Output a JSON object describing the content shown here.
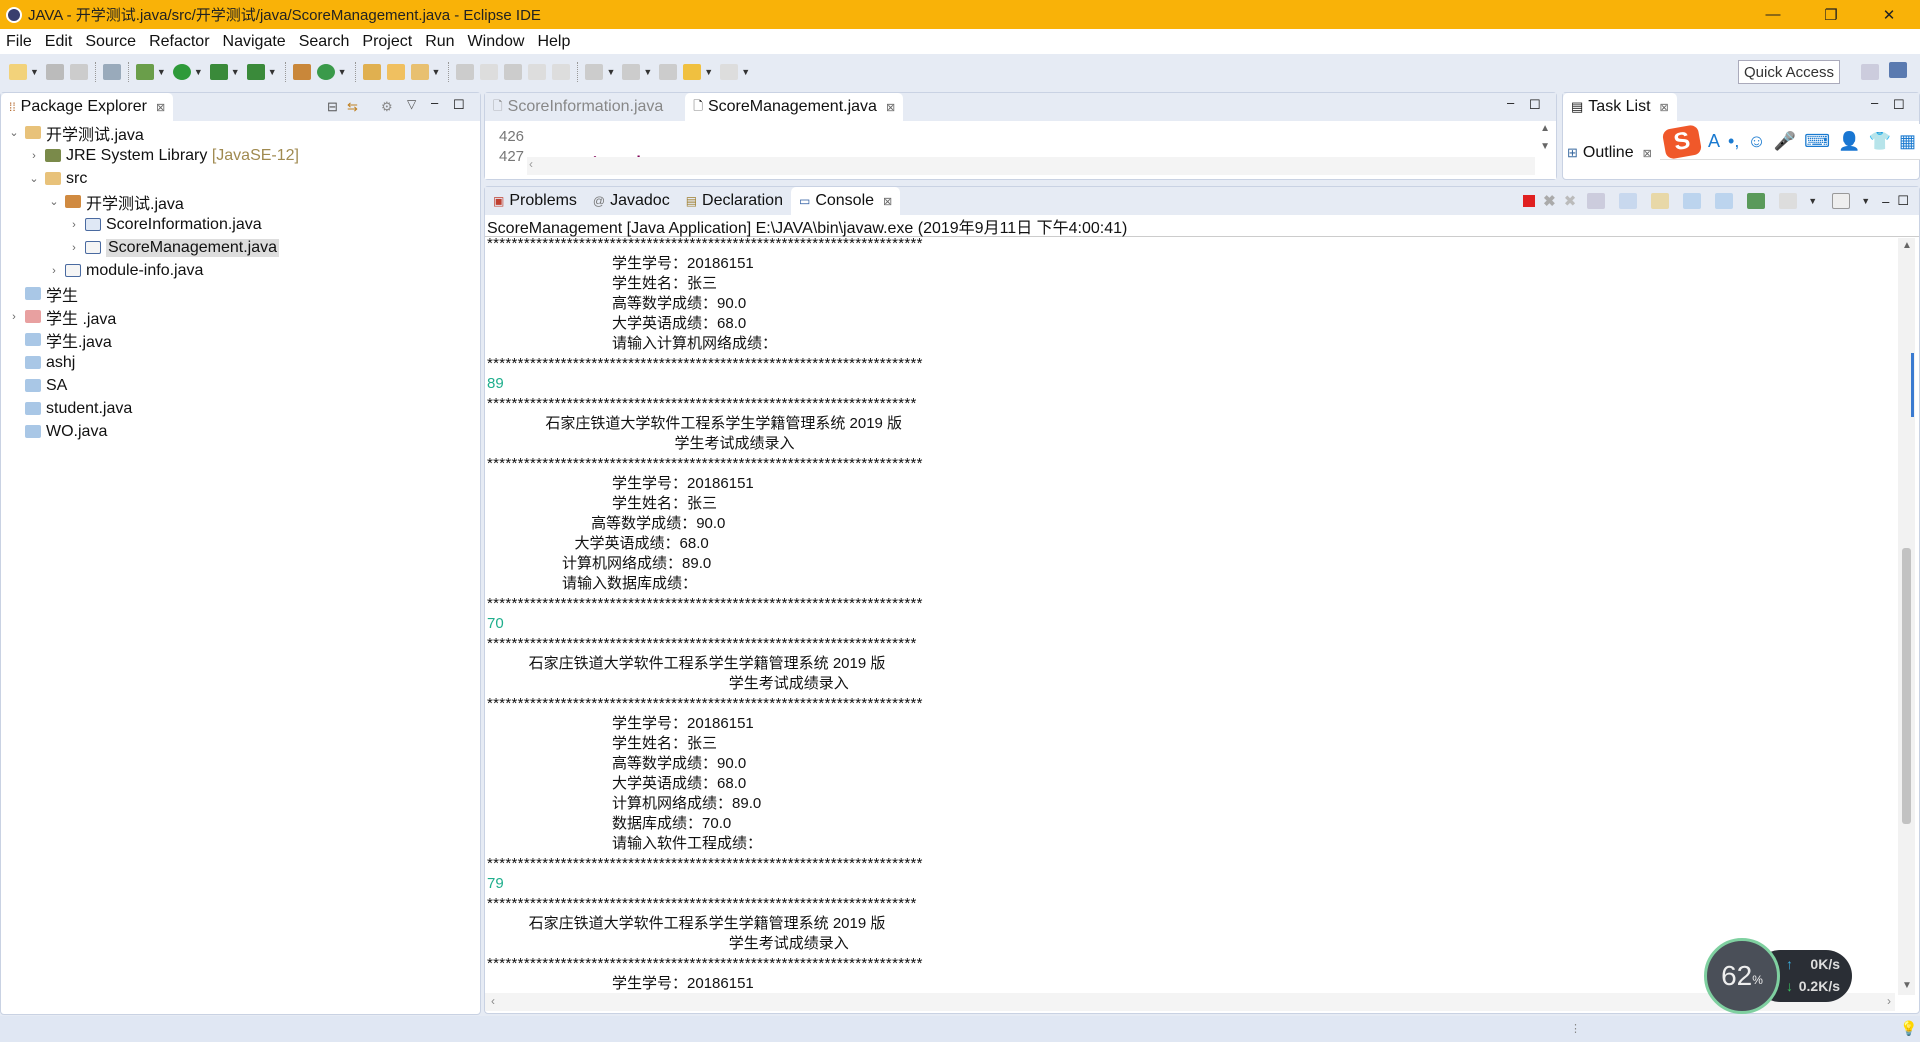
{
  "window": {
    "title": "JAVA - 开学测试.java/src/开学测试/java/ScoreManagement.java - Eclipse IDE",
    "minimize": "—",
    "restore": "❐",
    "close": "✕"
  },
  "menu": [
    "File",
    "Edit",
    "Source",
    "Refactor",
    "Navigate",
    "Search",
    "Project",
    "Run",
    "Window",
    "Help"
  ],
  "toolbar": {
    "quick_access": "Quick Access"
  },
  "package_explorer": {
    "title": "Package Explorer",
    "items": [
      {
        "label": "开学测试.java",
        "toggle": "⌄"
      },
      {
        "label": "JRE System Library",
        "decoration": "[JavaSE-12]",
        "toggle": "›"
      },
      {
        "label": "src",
        "toggle": "⌄"
      },
      {
        "label": "开学测试.java",
        "toggle": "⌄"
      },
      {
        "label": "ScoreInformation.java",
        "toggle": "›"
      },
      {
        "label": "ScoreManagement.java",
        "toggle": "›"
      },
      {
        "label": "module-info.java",
        "toggle": "›"
      },
      {
        "label": "学生",
        "toggle": ""
      },
      {
        "label": "学生 .java",
        "toggle": "›"
      },
      {
        "label": "学生.java",
        "toggle": ""
      },
      {
        "label": "ashj",
        "toggle": ""
      },
      {
        "label": "SA",
        "toggle": ""
      },
      {
        "label": "student.java",
        "toggle": ""
      },
      {
        "label": "WO.java",
        "toggle": ""
      }
    ]
  },
  "editor": {
    "tabs": [
      "ScoreInformation.java",
      "ScoreManagement.java"
    ],
    "active_tab": 1,
    "line_numbers": [
      "426",
      "427"
    ],
    "code_fragment": "return k;"
  },
  "task_list": {
    "title": "Task List"
  },
  "outline": {
    "title": "Outline"
  },
  "console": {
    "tabs": [
      "Problems",
      "Javadoc",
      "Declaration",
      "Console"
    ],
    "active_tab": 3,
    "header": "ScoreManagement [Java Application] E:\\JAVA\\bin\\javaw.exe (2019年9月11日 下午4:00:41)",
    "lines": [
      {
        "k": "stars",
        "t": "***********************************************************************"
      },
      {
        "k": "out",
        "t": "                              学生学号：20186151"
      },
      {
        "k": "out",
        "t": "                              学生姓名：张三"
      },
      {
        "k": "out",
        "t": "                              高等数学成绩：90.0"
      },
      {
        "k": "out",
        "t": "                              大学英语成绩：68.0"
      },
      {
        "k": "out",
        "t": "                              请输入计算机网络成绩："
      },
      {
        "k": "stars",
        "t": "***********************************************************************"
      },
      {
        "k": "input",
        "t": "89"
      },
      {
        "k": "stars",
        "t": "**********************************************************************"
      },
      {
        "k": "out",
        "t": "              石家庄铁道大学软件工程系学生学籍管理系统 2019 版"
      },
      {
        "k": "out",
        "t": "                                             学生考试成绩录入"
      },
      {
        "k": "stars",
        "t": "***********************************************************************"
      },
      {
        "k": "out",
        "t": "                              学生学号：20186151"
      },
      {
        "k": "out",
        "t": "                              学生姓名：张三"
      },
      {
        "k": "out",
        "t": "                         高等数学成绩：90.0"
      },
      {
        "k": "out",
        "t": "                     大学英语成绩：68.0"
      },
      {
        "k": "out",
        "t": "                  计算机网络成绩：89.0"
      },
      {
        "k": "out",
        "t": "                  请输入数据库成绩："
      },
      {
        "k": "stars",
        "t": "***********************************************************************"
      },
      {
        "k": "input",
        "t": "70"
      },
      {
        "k": "stars",
        "t": "**********************************************************************"
      },
      {
        "k": "out",
        "t": "          石家庄铁道大学软件工程系学生学籍管理系统 2019 版"
      },
      {
        "k": "out",
        "t": "                                                          学生考试成绩录入"
      },
      {
        "k": "stars",
        "t": "***********************************************************************"
      },
      {
        "k": "out",
        "t": "                              学生学号：20186151"
      },
      {
        "k": "out",
        "t": "                              学生姓名：张三"
      },
      {
        "k": "out",
        "t": "                              高等数学成绩：90.0"
      },
      {
        "k": "out",
        "t": "                              大学英语成绩：68.0"
      },
      {
        "k": "out",
        "t": "                              计算机网络成绩：89.0"
      },
      {
        "k": "out",
        "t": "                              数据库成绩：70.0"
      },
      {
        "k": "out",
        "t": "                              请输入软件工程成绩："
      },
      {
        "k": "stars",
        "t": "***********************************************************************"
      },
      {
        "k": "input",
        "t": "79"
      },
      {
        "k": "stars",
        "t": "**********************************************************************"
      },
      {
        "k": "out",
        "t": "          石家庄铁道大学软件工程系学生学籍管理系统 2019 版"
      },
      {
        "k": "out",
        "t": "                                                          学生考试成绩录入"
      },
      {
        "k": "stars",
        "t": "***********************************************************************"
      },
      {
        "k": "out",
        "t": "                              学生学号：20186151"
      }
    ]
  },
  "net_monitor": {
    "percent": "62",
    "percent_sign": "%",
    "upload": "0K/s",
    "download": "0.2K/s",
    "upload_arrow": "↑",
    "download_arrow": "↓"
  },
  "ime": {
    "logo": "S",
    "items": [
      "A",
      "•,",
      "☺",
      "🎤",
      "⌨",
      "👤",
      "👕",
      "▦"
    ]
  },
  "colors": {
    "title_bar": "#f9b208",
    "console_input": "#1fae8c",
    "ime_logo": "#f0582a"
  }
}
